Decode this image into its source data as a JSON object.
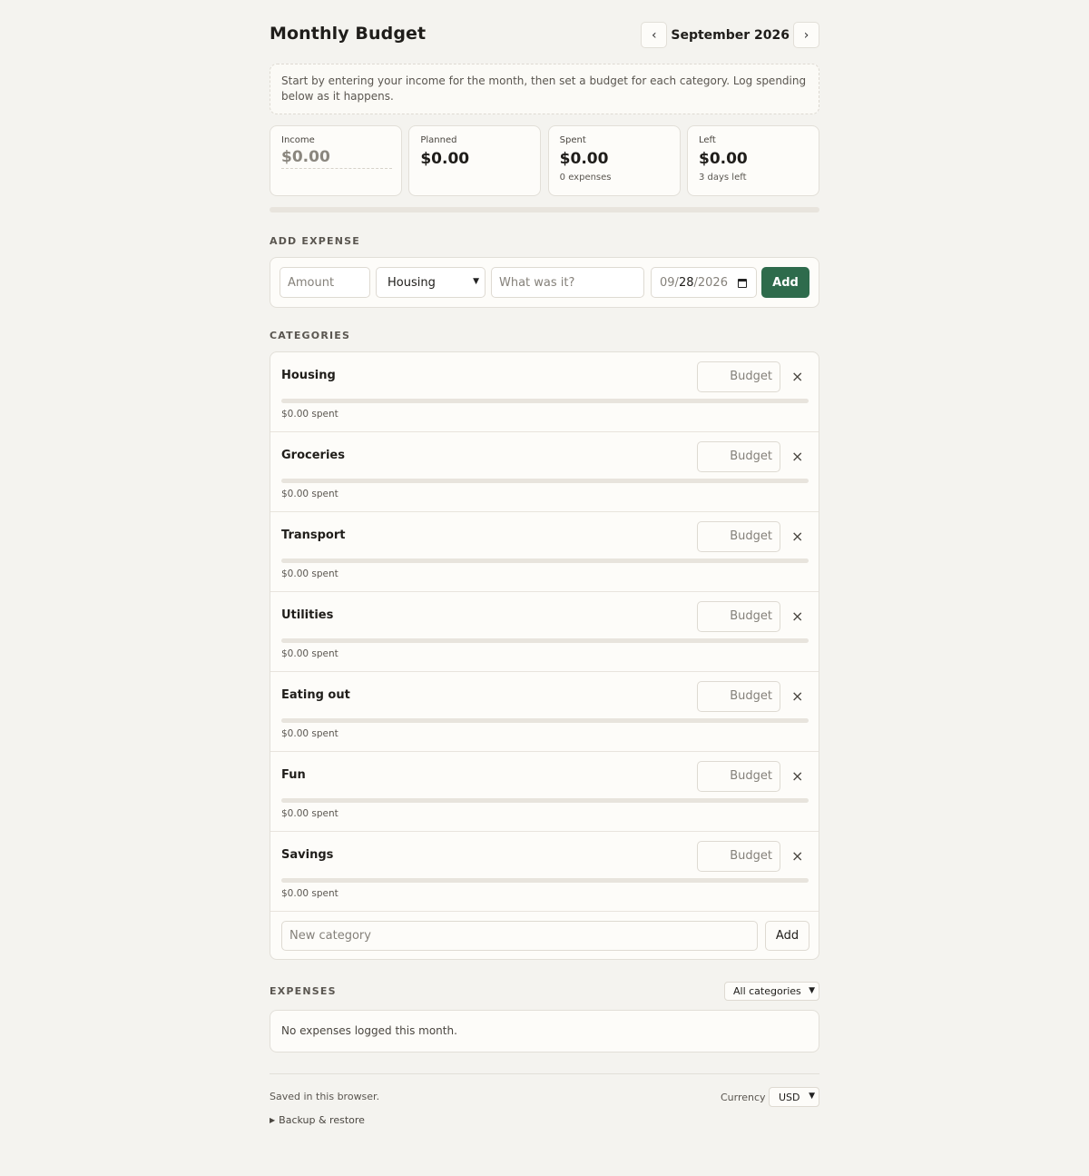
{
  "header": {
    "title": "Monthly Budget",
    "month": "September 2026",
    "prev_icon": "‹",
    "next_icon": "›"
  },
  "hint": "Start by entering your income for the month, then set a budget for each category. Log spending below as it happens.",
  "summary": {
    "income": {
      "label": "Income",
      "placeholder": "$0.00"
    },
    "planned": {
      "label": "Planned",
      "value": "$0.00"
    },
    "spent": {
      "label": "Spent",
      "value": "$0.00",
      "sub": "0 expenses"
    },
    "left": {
      "label": "Left",
      "value": "$0.00",
      "sub": "3 days left"
    },
    "spent_fraction": 0
  },
  "add_expense": {
    "section_title": "ADD EXPENSE",
    "amount_placeholder": "Amount",
    "category_value": "Housing",
    "description_placeholder": "What was it?",
    "date_month": "09",
    "date_day": "28",
    "date_year": "2026",
    "add_label": "Add"
  },
  "categories": {
    "section_title": "CATEGORIES",
    "budget_placeholder": "Budget",
    "remove_icon": "×",
    "items": [
      {
        "name": "Housing",
        "spent": "$0.00 spent",
        "fraction": 0
      },
      {
        "name": "Groceries",
        "spent": "$0.00 spent",
        "fraction": 0
      },
      {
        "name": "Transport",
        "spent": "$0.00 spent",
        "fraction": 0
      },
      {
        "name": "Utilities",
        "spent": "$0.00 spent",
        "fraction": 0
      },
      {
        "name": "Eating out",
        "spent": "$0.00 spent",
        "fraction": 0
      },
      {
        "name": "Fun",
        "spent": "$0.00 spent",
        "fraction": 0
      },
      {
        "name": "Savings",
        "spent": "$0.00 spent",
        "fraction": 0
      }
    ],
    "new_placeholder": "New category",
    "new_add_label": "Add"
  },
  "expenses": {
    "section_title": "EXPENSES",
    "filter_value": "All categories",
    "empty_text": "No expenses logged this month."
  },
  "footer": {
    "saved_text": "Saved in this browser.",
    "currency_label": "Currency",
    "currency_value": "USD",
    "backup_label": "Backup & restore"
  },
  "colors": {
    "accent": "#2e6b4c",
    "background": "#f4f3ef",
    "card": "#fdfcf9"
  }
}
